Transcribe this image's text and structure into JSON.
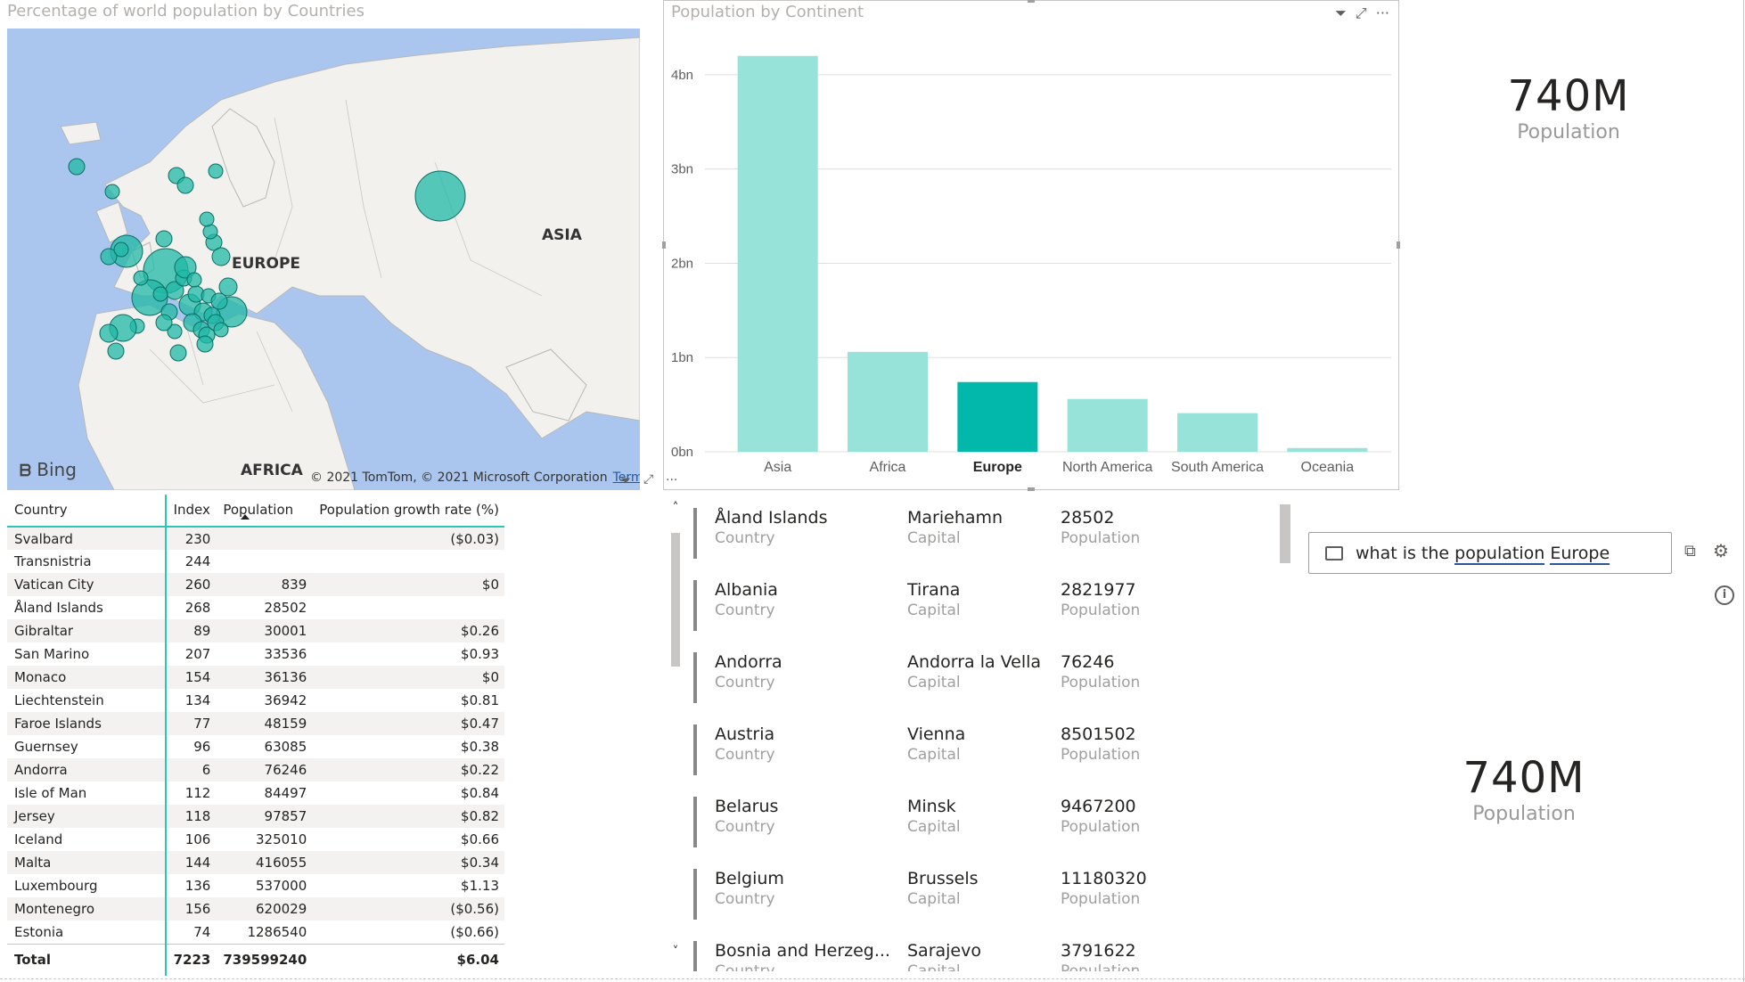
{
  "map": {
    "title": "Percentage of world population by Countries",
    "labels": {
      "europe": "EUROPE",
      "asia": "ASIA",
      "africa": "AFRICA"
    },
    "bing": "Bing",
    "attribution": "© 2021 TomTom, © 2021 Microsoft Corporation",
    "terms": "Terms",
    "bubble_color": "#20b8a6"
  },
  "bar_chart": {
    "title": "Population by Continent"
  },
  "chart_data": {
    "type": "bar",
    "title": "Population by Continent",
    "categories": [
      "Asia",
      "Africa",
      "Europe",
      "North America",
      "South America",
      "Oceania"
    ],
    "values": [
      4.2,
      1.06,
      0.74,
      0.56,
      0.41,
      0.04
    ],
    "ytick_labels": [
      "0bn",
      "1bn",
      "2bn",
      "3bn",
      "4bn"
    ],
    "ylim": [
      0,
      4.5
    ],
    "highlighted": "Europe",
    "colors": {
      "normal": "#97e2d9",
      "highlighted": "#01b8aa"
    },
    "grid": true
  },
  "cards": [
    {
      "value": "740M",
      "label": "Population"
    },
    {
      "value": "740M",
      "label": "Population"
    }
  ],
  "table": {
    "headers": [
      "Country",
      "Index",
      "Population",
      "Population growth rate (%)"
    ],
    "rows": [
      [
        "Svalbard",
        "230",
        "",
        "($0.03)"
      ],
      [
        "Transnistria",
        "244",
        "",
        ""
      ],
      [
        "Vatican City",
        "260",
        "839",
        "$0"
      ],
      [
        "Åland Islands",
        "268",
        "28502",
        ""
      ],
      [
        "Gibraltar",
        "89",
        "30001",
        "$0.26"
      ],
      [
        "San Marino",
        "207",
        "33536",
        "$0.93"
      ],
      [
        "Monaco",
        "154",
        "36136",
        "$0"
      ],
      [
        "Liechtenstein",
        "134",
        "36942",
        "$0.81"
      ],
      [
        "Faroe Islands",
        "77",
        "48159",
        "$0.47"
      ],
      [
        "Guernsey",
        "96",
        "63085",
        "$0.38"
      ],
      [
        "Andorra",
        "6",
        "76246",
        "$0.22"
      ],
      [
        "Isle of Man",
        "112",
        "84497",
        "$0.84"
      ],
      [
        "Jersey",
        "118",
        "97857",
        "$0.82"
      ],
      [
        "Iceland",
        "106",
        "325010",
        "$0.66"
      ],
      [
        "Malta",
        "144",
        "416055",
        "$0.34"
      ],
      [
        "Luxembourg",
        "136",
        "537000",
        "$1.13"
      ],
      [
        "Montenegro",
        "156",
        "620029",
        "($0.56)"
      ],
      [
        "Estonia",
        "74",
        "1286540",
        "($0.66)"
      ]
    ],
    "total": [
      "Total",
      "7223",
      "739599240",
      "$6.04"
    ]
  },
  "multirow": {
    "items": [
      {
        "country": "Åland Islands",
        "capital": "Mariehamn",
        "population": "28502"
      },
      {
        "country": "Albania",
        "capital": "Tirana",
        "population": "2821977"
      },
      {
        "country": "Andorra",
        "capital": "Andorra la Vella",
        "population": "76246"
      },
      {
        "country": "Austria",
        "capital": "Vienna",
        "population": "8501502"
      },
      {
        "country": "Belarus",
        "capital": "Minsk",
        "population": "9467200"
      },
      {
        "country": "Belgium",
        "capital": "Brussels",
        "population": "11180320"
      },
      {
        "country": "Bosnia and Herzeg...",
        "capital": "Sarajevo",
        "population": "3791622"
      }
    ],
    "labels": {
      "country": "Country",
      "capital": "Capital",
      "population": "Population"
    }
  },
  "qa": {
    "query_prefix": "what is the ",
    "query_word1": "population",
    "query_sep": " ",
    "query_word2": "Europe"
  },
  "icons": {
    "filter": "filter-icon",
    "focus": "focus-mode-icon",
    "more": "more-options-icon",
    "info": "info-icon",
    "settings": "gear-icon"
  }
}
